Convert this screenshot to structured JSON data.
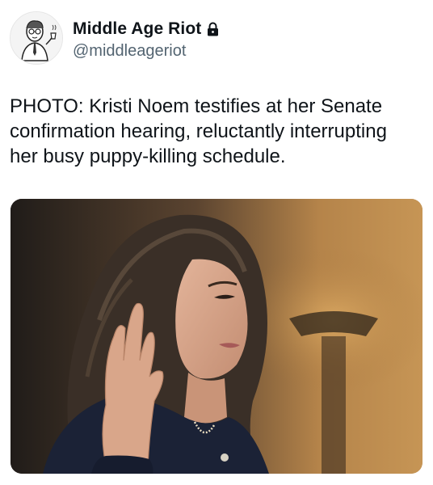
{
  "author": {
    "display_name": "Middle Age Riot",
    "handle": "@middleageriot",
    "protected": true,
    "avatar_icon": "cartoon-man-avatar-icon"
  },
  "tweet": {
    "text": "PHOTO: Kristi Noem testifies at her Senate\nconfirmation hearing, reluctantly interrupting\nher busy puppy-killing schedule."
  },
  "media": {
    "type": "photo"
  },
  "colors": {
    "text_primary": "#0f1419",
    "text_secondary": "#536471",
    "background": "#ffffff"
  }
}
